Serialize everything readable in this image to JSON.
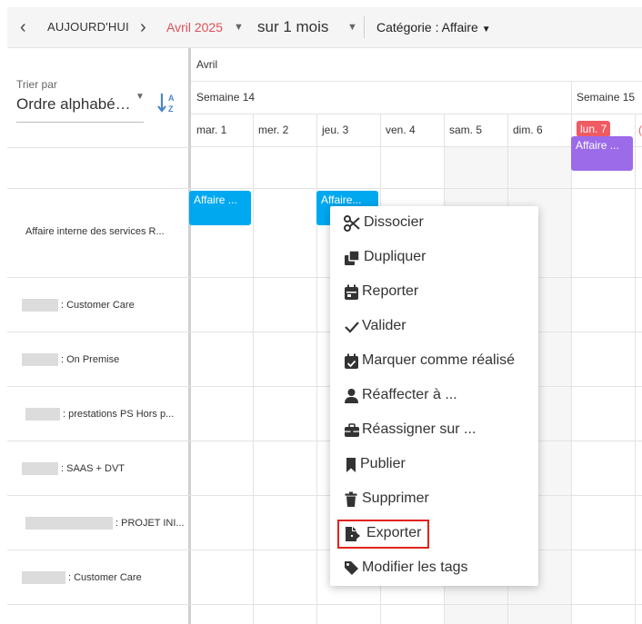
{
  "toolbar": {
    "prev_icon": "chevron-left-icon",
    "today_label": "AUJOURD'HUI",
    "next_icon": "chevron-right-icon",
    "month_label": "Avril 2025",
    "period_label": "sur 1 mois",
    "category_label": "Catégorie : Affaire"
  },
  "sort": {
    "label": "Trier par",
    "value": "Ordre alphabé…"
  },
  "calendar": {
    "month": "Avril",
    "weeks": [
      "Semaine 14",
      "Semaine 15"
    ],
    "days": [
      "mar. 1",
      "mer. 2",
      "jeu. 3",
      "ven. 4",
      "sam. 5",
      "dim. 6",
      "lun. 7"
    ],
    "events": [
      "Affaire ...",
      "Affaire...",
      "Affaire ..."
    ]
  },
  "rows": [
    {
      "label": "Affaire interne des services R..."
    },
    {
      "label": ": Customer Care"
    },
    {
      "label": ": On Premise"
    },
    {
      "label": ": prestations PS Hors p..."
    },
    {
      "label": ": SAAS + DVT"
    },
    {
      "label": ": PROJET INI..."
    },
    {
      "label": ": Customer Care"
    }
  ],
  "context_menu": {
    "items": [
      {
        "label": "Dissocier",
        "icon": "scissors-icon"
      },
      {
        "label": "Dupliquer",
        "icon": "copy-icon"
      },
      {
        "label": "Reporter",
        "icon": "calendar-icon"
      },
      {
        "label": "Valider",
        "icon": "check-icon"
      },
      {
        "label": "Marquer comme réalisé",
        "icon": "calendar-check-icon"
      },
      {
        "label": "Réaffecter à ...",
        "icon": "user-icon"
      },
      {
        "label": "Réassigner sur ...",
        "icon": "briefcase-icon"
      },
      {
        "label": "Publier",
        "icon": "bookmark-icon"
      },
      {
        "label": "Supprimer",
        "icon": "trash-icon"
      },
      {
        "label": "Exporter",
        "icon": "file-export-icon"
      },
      {
        "label": "Modifier les tags",
        "icon": "tag-icon"
      }
    ]
  },
  "colors": {
    "event_blue": "#00a8f0",
    "event_purple": "#9b6bea",
    "today_red": "#ef5a63",
    "month_red": "#e0505a",
    "highlight": "#e2231a"
  }
}
